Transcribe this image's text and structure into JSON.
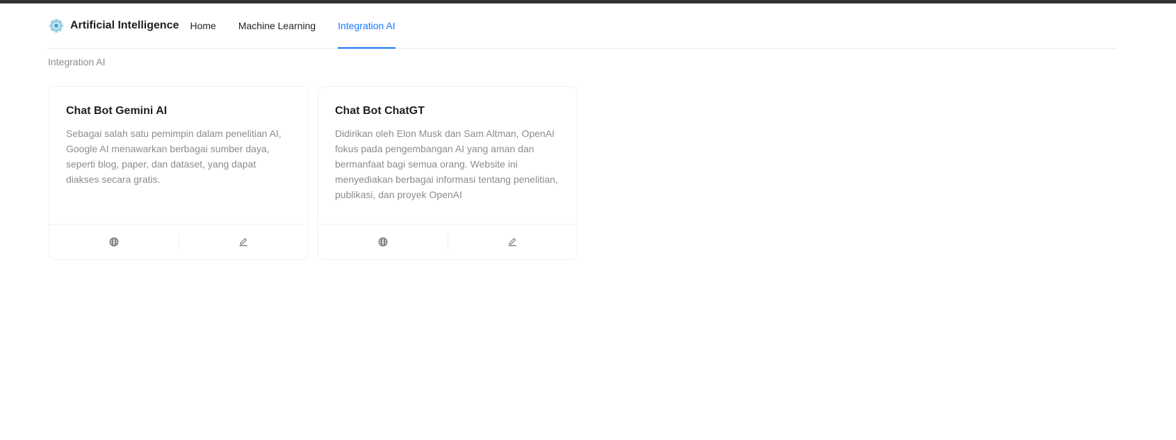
{
  "app": {
    "title": "Artificial Intelligence",
    "logo_icon": "ai-brain-icon"
  },
  "nav": {
    "items": [
      {
        "label": "Home",
        "active": false
      },
      {
        "label": "Machine Learning",
        "active": false
      },
      {
        "label": "Integration AI",
        "active": true
      }
    ]
  },
  "breadcrumb": {
    "current": "Integration AI"
  },
  "cards": [
    {
      "title": "Chat Bot Gemini AI",
      "description": "Sebagai salah satu pemimpin dalam penelitian AI, Google AI menawarkan berbagai sumber daya, seperti blog, paper, dan dataset, yang dapat diakses secara gratis.",
      "actions": [
        "globe-icon",
        "edit-icon"
      ]
    },
    {
      "title": "Chat Bot ChatGT",
      "description": "Didirikan oleh Elon Musk dan Sam Altman, OpenAI fokus pada pengembangan AI yang aman dan bermanfaat bagi semua orang. Website ini menyediakan berbagai informasi tentang penelitian, publikasi, dan proyek OpenAI",
      "actions": [
        "globe-icon",
        "edit-icon"
      ]
    }
  ],
  "colors": {
    "accent": "#1677ff",
    "top_bar": "#333333",
    "muted_text": "#8c8c8c"
  }
}
